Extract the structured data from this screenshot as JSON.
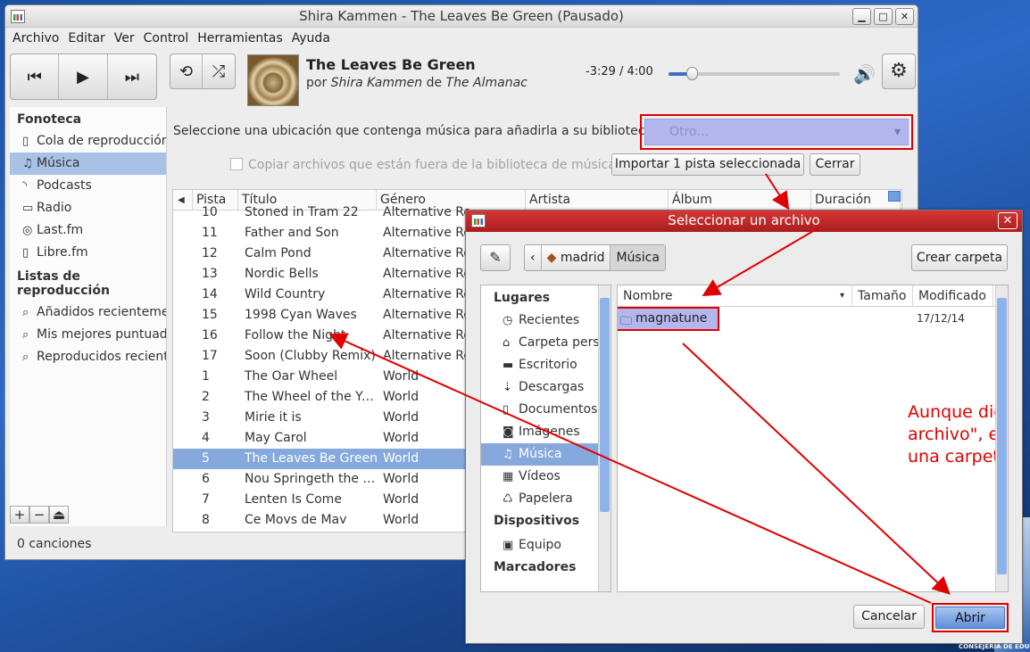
{
  "window": {
    "title": "Shira Kammen - The Leaves Be Green (Pausado)",
    "minimize": "▁",
    "maximize": "□",
    "close": "✕"
  },
  "menu": [
    "Archivo",
    "Editar",
    "Ver",
    "Control",
    "Herramientas",
    "Ayuda"
  ],
  "toolbar": {
    "prev_icon": "⏮",
    "play_icon": "▶",
    "next_icon": "⏭",
    "repeat_icon": "⟲",
    "shuffle_icon": "⤮",
    "track_title": "The Leaves Be Green",
    "by_prefix": "por",
    "artist": "Shira Kammen",
    "of_prefix": "de",
    "album": "The Almanac",
    "time": "-3:29 / 4:00",
    "progress": 0.13,
    "volume_icon": "🔊",
    "gear_icon": "⚙"
  },
  "sidebar": {
    "library_heading": "Fonoteca",
    "library_items": [
      {
        "icon": "▯",
        "label": "Cola de reproducción"
      },
      {
        "icon": "♫",
        "label": "Música",
        "selected": true
      },
      {
        "icon": "◝",
        "label": "Podcasts"
      },
      {
        "icon": "▭",
        "label": "Radio"
      },
      {
        "icon": "◎",
        "label": "Last.fm"
      },
      {
        "icon": "▯",
        "label": "Libre.fm"
      }
    ],
    "playlists_heading": "Listas de reproducción",
    "playlist_items": [
      {
        "icon": "⌕",
        "label": "Añadidos recientemente"
      },
      {
        "icon": "⌕",
        "label": "Mis mejores puntuadas"
      },
      {
        "icon": "⌕",
        "label": "Reproducidos recientemente"
      }
    ],
    "add": "+",
    "remove": "−",
    "eject": "⏏"
  },
  "status": "0 canciones",
  "import_bar": {
    "label": "Seleccione una ubicación que contenga música para añadirla a su biblioteca:",
    "location_value": "Otro…",
    "copy_label": "Copiar archivos que están fuera de la biblioteca de música",
    "import_button": "Importar 1 pista seleccionada",
    "close_button": "Cerrar"
  },
  "tracklist": {
    "columns": [
      "Pista",
      "Título",
      "Género",
      "Artista",
      "Álbum",
      "Duración"
    ],
    "speaker_icon": "◀",
    "rows": [
      [
        "10",
        "Stoned in Tram 22",
        "Alternative Ro"
      ],
      [
        "11",
        "Father and Son",
        "Alternative Ro"
      ],
      [
        "12",
        "Calm Pond",
        "Alternative Ro"
      ],
      [
        "13",
        "Nordic Bells",
        "Alternative Ro"
      ],
      [
        "14",
        "Wild Country",
        "Alternative Ro"
      ],
      [
        "15",
        "1998 Cyan Waves",
        "Alternative Ro"
      ],
      [
        "16",
        "Follow the Night",
        "Alternative Ro"
      ],
      [
        "17",
        "Soon (Clubby Remix)",
        "Alternative Ro"
      ],
      [
        "1",
        "The Oar Wheel",
        "World"
      ],
      [
        "2",
        "The Wheel of the Year",
        "World"
      ],
      [
        "3",
        "Mirie it is",
        "World"
      ],
      [
        "4",
        "May Carol",
        "World"
      ],
      [
        "5",
        "The Leaves Be Green",
        "World"
      ],
      [
        "6",
        "Nou Springeth the Sprai",
        "World"
      ],
      [
        "7",
        "Lenten Is Come",
        "World"
      ],
      [
        "8",
        "Ce Moys de May",
        "World"
      ]
    ],
    "selected_index": 12
  },
  "dialog": {
    "title": "Seleccionar un archivo",
    "close": "✕",
    "edit_icon": "✎",
    "path": [
      "‹",
      "madrid",
      "Música"
    ],
    "create_folder": "Crear carpeta",
    "places_heading": "Lugares",
    "places": [
      {
        "icon": "◷",
        "label": "Recientes"
      },
      {
        "icon": "⌂",
        "label": "Carpeta personal"
      },
      {
        "icon": "▬",
        "label": "Escritorio"
      },
      {
        "icon": "⇣",
        "label": "Descargas"
      },
      {
        "icon": "▯",
        "label": "Documentos"
      },
      {
        "icon": "◙",
        "label": "Imágenes"
      },
      {
        "icon": "♫",
        "label": "Música",
        "selected": true
      },
      {
        "icon": "▦",
        "label": "Vídeos"
      },
      {
        "icon": "♺",
        "label": "Papelera"
      }
    ],
    "devices_heading": "Dispositivos",
    "devices": [
      {
        "icon": "▣",
        "label": "Equipo"
      }
    ],
    "bookmarks_heading": "Marcadores",
    "file_columns": [
      "Nombre",
      "Tamaño",
      "Modificado"
    ],
    "file": {
      "icon": "🗀",
      "name": "magnatune",
      "modified": "17/12/14"
    },
    "cancel": "Cancelar",
    "open": "Abrir"
  },
  "annotation": "Aunque diga \"seleccionar un archivo\", es mejor que sea una carpeta.",
  "desktop": {
    "footer": "CONSEJERÍA DE EDUCACIÓN"
  }
}
